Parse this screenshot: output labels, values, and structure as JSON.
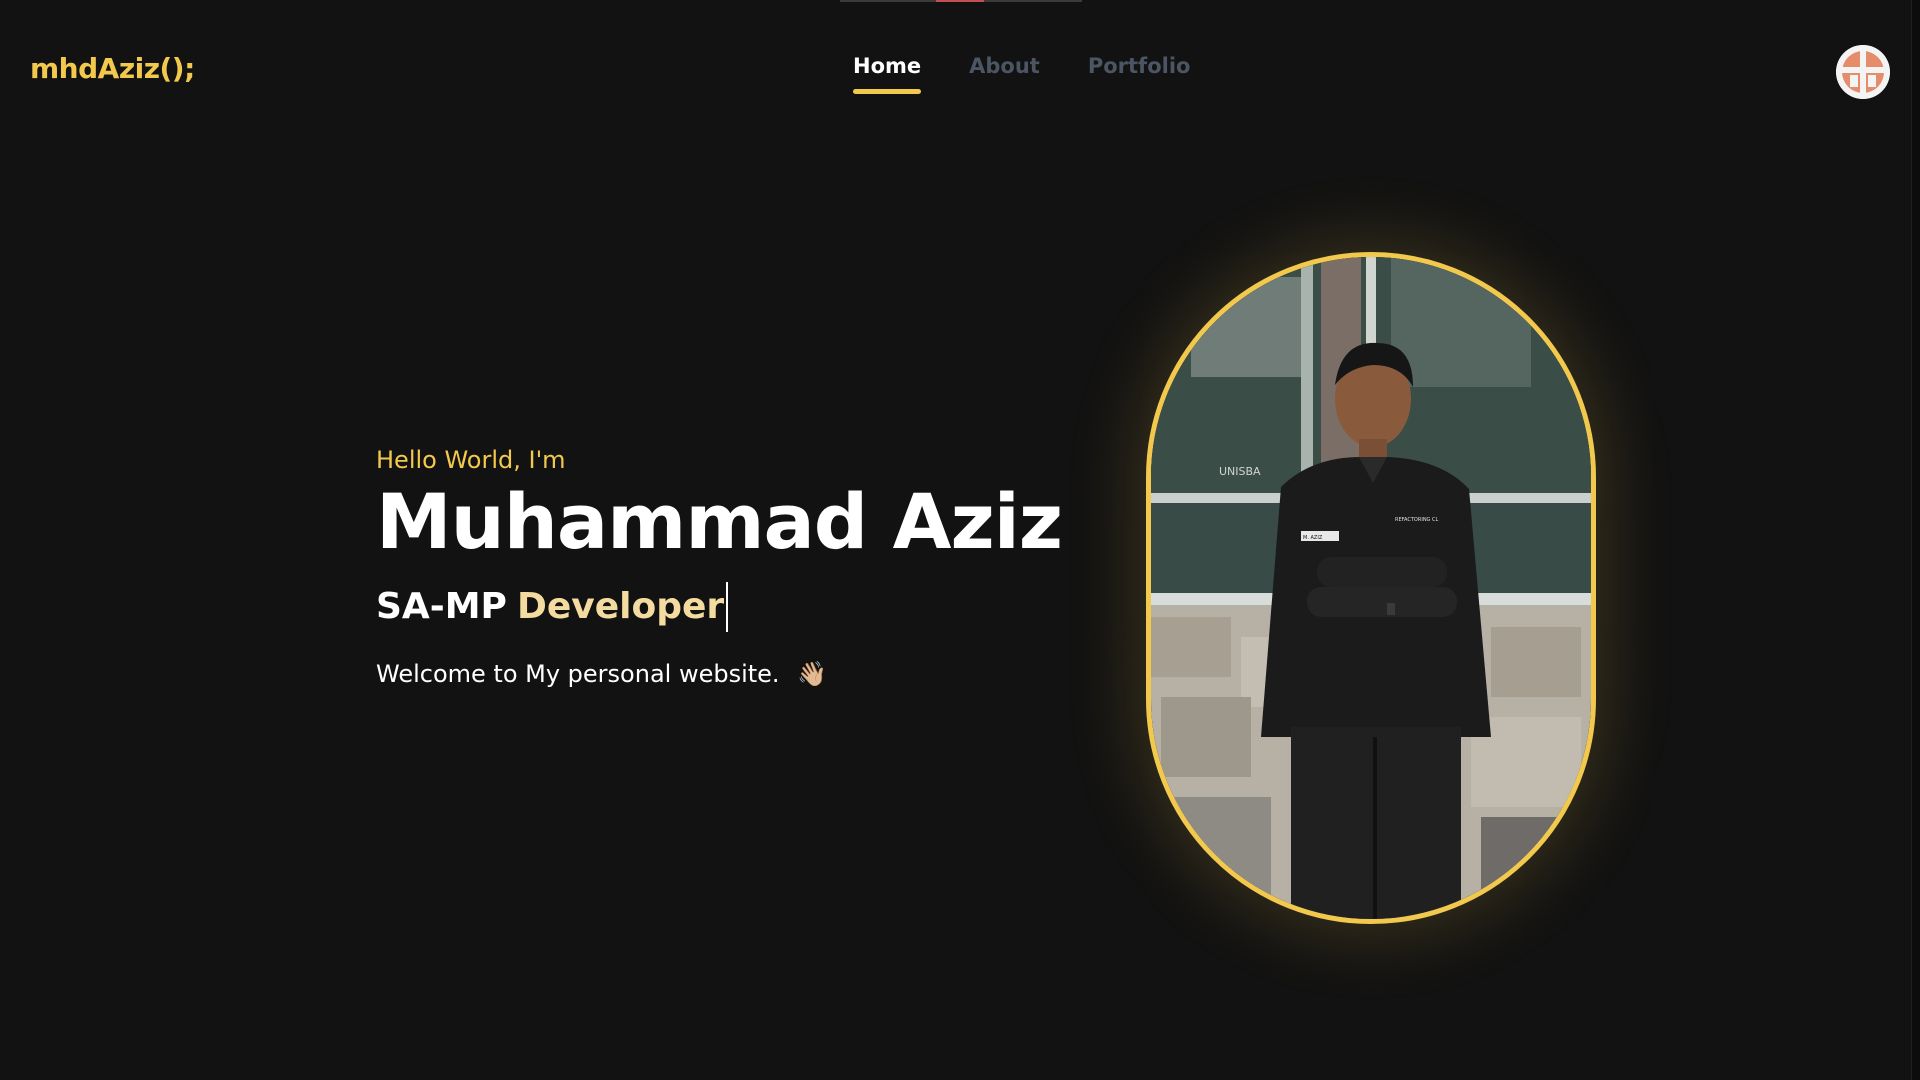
{
  "header": {
    "logo": "mhdAziz();",
    "nav": [
      {
        "label": "Home",
        "active": true
      },
      {
        "label": "About",
        "active": false
      },
      {
        "label": "Portfolio",
        "active": false
      }
    ],
    "avatar_icon": "profile-avatar-icon"
  },
  "hero": {
    "greeting": "Hello World, I'm",
    "name": "Muhammad Aziz",
    "role_prefix": "SA-MP",
    "role_suffix": "Developer",
    "welcome": "Welcome to My personal website.",
    "welcome_emoji": "👋🏼",
    "photo_sign_text": "UNISBA",
    "photo_badge_name": "M. AZIZ",
    "photo_badge_team": "REFACTORING CL"
  },
  "colors": {
    "background": "#121212",
    "accent": "#f2c94c",
    "role_suffix": "#f4dba0",
    "nav_inactive": "#4b5563",
    "text": "#ffffff"
  }
}
